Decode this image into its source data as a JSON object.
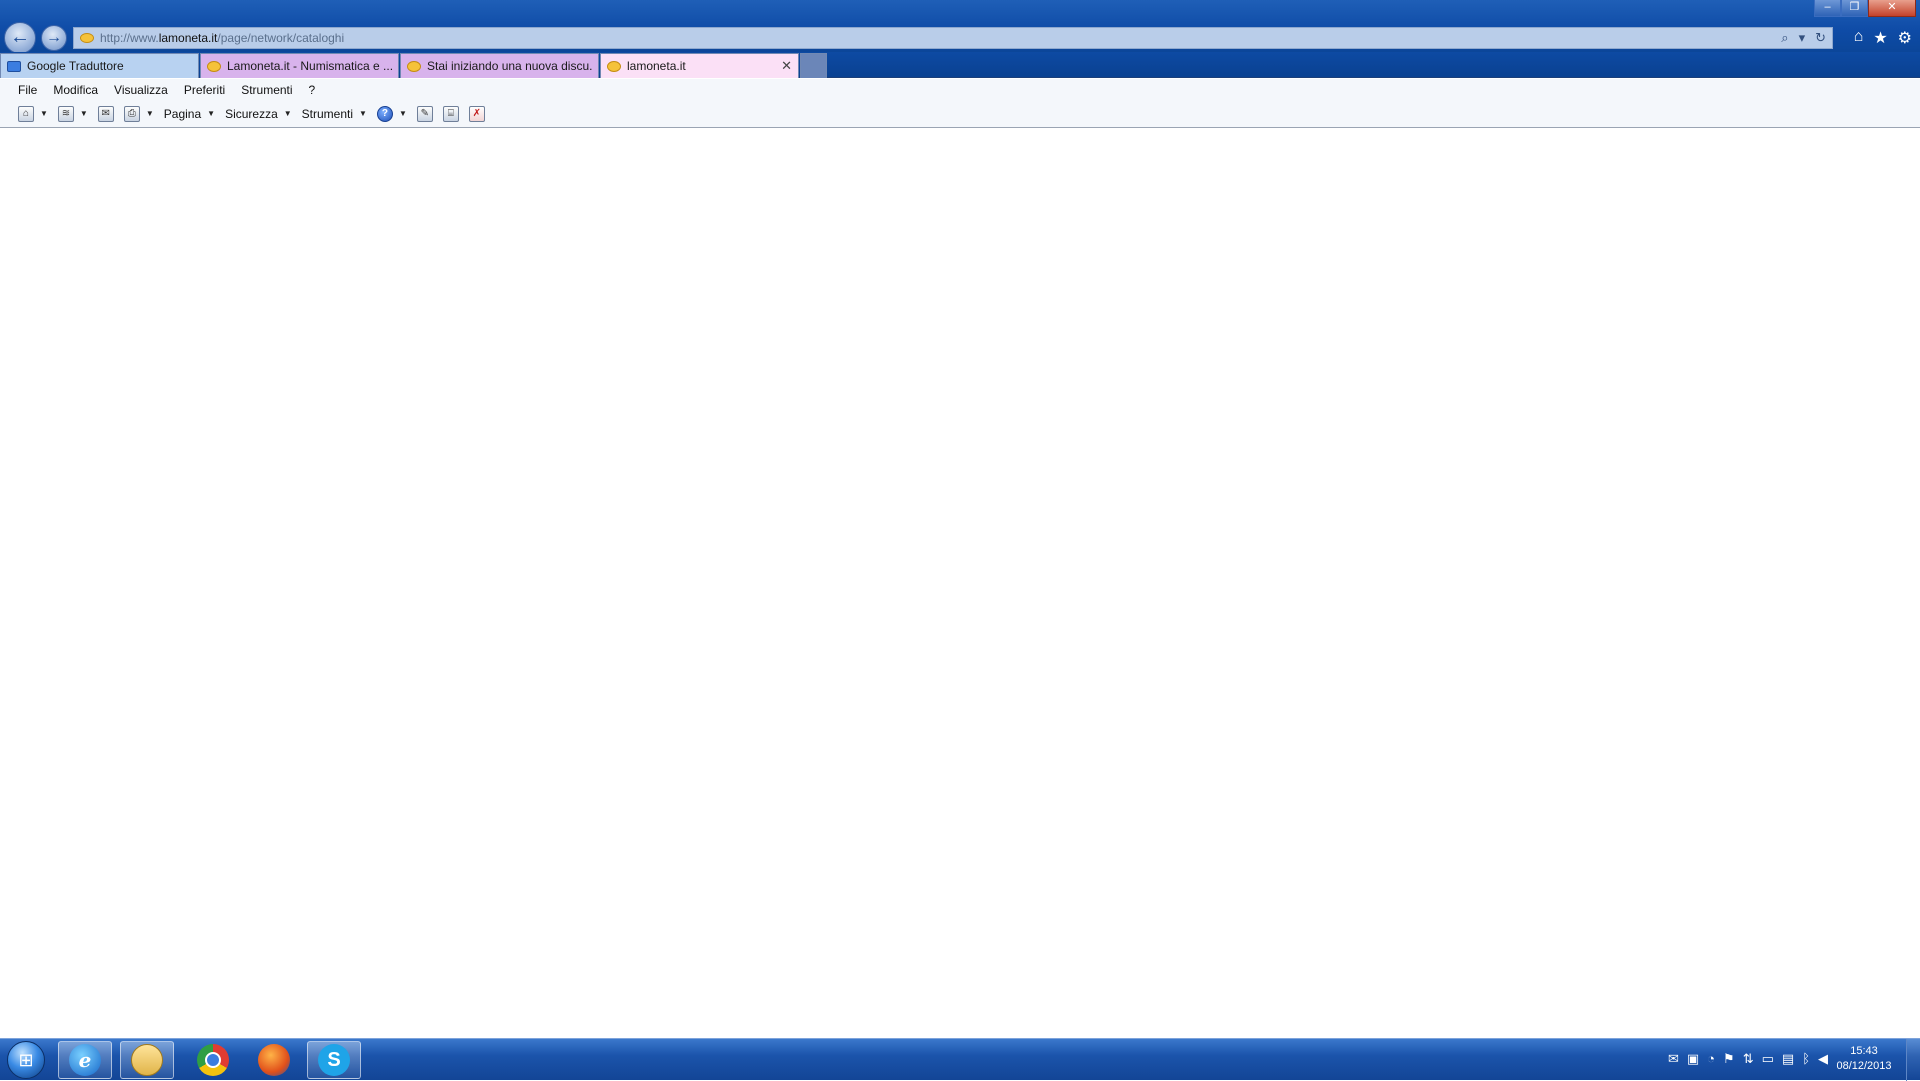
{
  "window_controls": {
    "minimize": "–",
    "restore": "❐",
    "close": "✕"
  },
  "navigation": {
    "back_glyph": "←",
    "forward_glyph": "→"
  },
  "address_bar": {
    "url_prefix": "http://www.",
    "url_host": "lamoneta.it",
    "url_path": "/page/network/cataloghi",
    "search_glyph": "⌕",
    "dropdown_glyph": "▾",
    "refresh_glyph": "↻"
  },
  "browser_tools": {
    "home_glyph": "⌂",
    "favorites_glyph": "★",
    "settings_glyph": "⚙"
  },
  "tabs": [
    {
      "label": "Google Traduttore",
      "icon": "google-translate-icon"
    },
    {
      "label": "Lamoneta.it - Numismatica e ...",
      "icon": "lamoneta-icon"
    },
    {
      "label": "Stai iniziando una nuova discu...",
      "icon": "lamoneta-icon"
    },
    {
      "label": "lamoneta.it",
      "icon": "lamoneta-icon",
      "close": "✕"
    }
  ],
  "menu": {
    "file": "File",
    "edit": "Modifica",
    "view": "Visualizza",
    "favorites": "Preferiti",
    "tools": "Strumenti",
    "help": "?"
  },
  "command_bar": {
    "home_glyph": "⌂",
    "feeds_glyph": "≋",
    "mail_glyph": "✉",
    "print_glyph": "⎙",
    "page_label": "Pagina",
    "security_label": "Sicurezza",
    "tools_label": "Strumenti",
    "help_glyph": "?",
    "research_glyph": "✎",
    "translate_glyph": "⌸",
    "blocker_glyph": "✗",
    "caret": "▼"
  },
  "taskbar": {
    "start_glyph": "⊞",
    "apps": [
      {
        "name": "internet-explorer",
        "glyph": "e"
      },
      {
        "name": "windows-explorer",
        "glyph": ""
      },
      {
        "name": "chrome",
        "glyph": ""
      },
      {
        "name": "firefox",
        "glyph": ""
      },
      {
        "name": "skype",
        "glyph": "S"
      }
    ],
    "tray_glyphs": [
      "✉",
      "▣",
      "◔",
      "⚑",
      "⇅",
      "▭",
      "▤",
      "ᛒ",
      "◀"
    ],
    "clock_time": "15:43",
    "clock_date": "08/12/2013"
  },
  "colors": {
    "title_bar": "#0e4ba6",
    "active_tab": "#fbe0f6",
    "lamoneta_tab": "#d8b3ec",
    "translate_tab": "#b8d2f1",
    "taskbar": "#1b54ab"
  }
}
